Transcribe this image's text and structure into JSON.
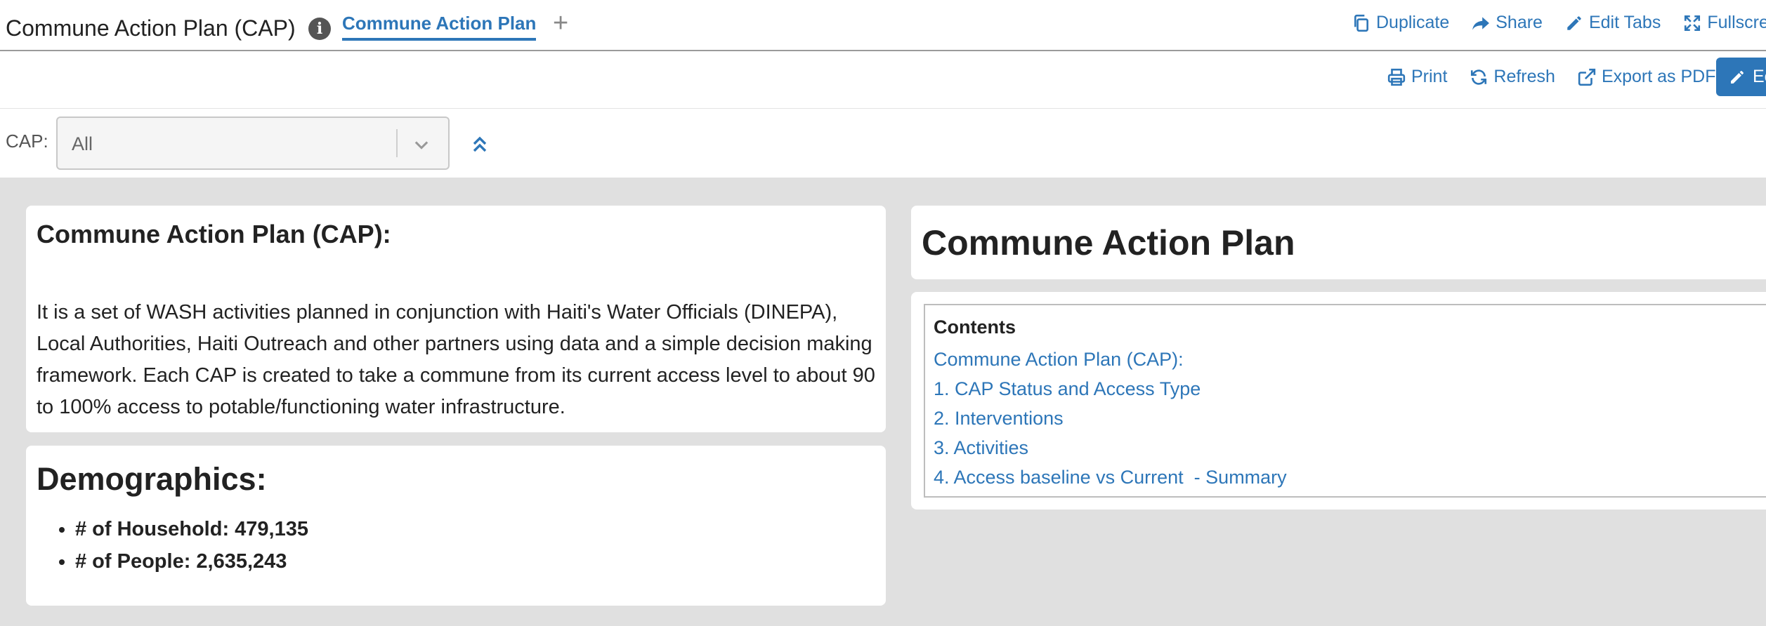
{
  "header": {
    "dashboard_title": "Commune Action Plan (CAP)",
    "info_icon": "info-circle-icon",
    "active_tab": "Commune Action Plan",
    "add_tab_icon": "plus-icon",
    "actions": [
      {
        "label": "Duplicate",
        "icon": "copy-icon"
      },
      {
        "label": "Share",
        "icon": "share-icon"
      },
      {
        "label": "Edit Tabs",
        "icon": "pencil-icon"
      },
      {
        "label": "Fullscre",
        "icon": "expand-icon"
      }
    ]
  },
  "toolbar": {
    "print_label": "Print",
    "refresh_label": "Refresh",
    "export_label": "Export as PDF",
    "edit_label": "Ec"
  },
  "filter": {
    "label": "CAP:",
    "selected_value": "All"
  },
  "cards": {
    "cap": {
      "heading": "Commune Action Plan (CAP):",
      "body": "It is a set of WASH activities planned in conjunction with Haiti's Water Officials (DINEPA), Local Authorities, Haiti Outreach and other partners using data and a simple decision making framework. Each CAP is created to take a commune from its current access level to about 90 to 100% access to potable/functioning water infrastructure."
    },
    "demographics": {
      "heading": "Demographics:",
      "items": [
        "# of Household: 479,135",
        "# of People: 2,635,243"
      ]
    },
    "title": {
      "heading": "Commune Action Plan"
    },
    "toc": {
      "heading": "Contents",
      "items": [
        "Commune Action Plan (CAP):",
        "1. CAP Status and Access Type",
        "2. Interventions",
        "3. Activities",
        "4. Access baseline vs Current  - Summary"
      ]
    }
  },
  "colors": {
    "accent": "#2d76b8",
    "background": "#e0e0e0"
  }
}
